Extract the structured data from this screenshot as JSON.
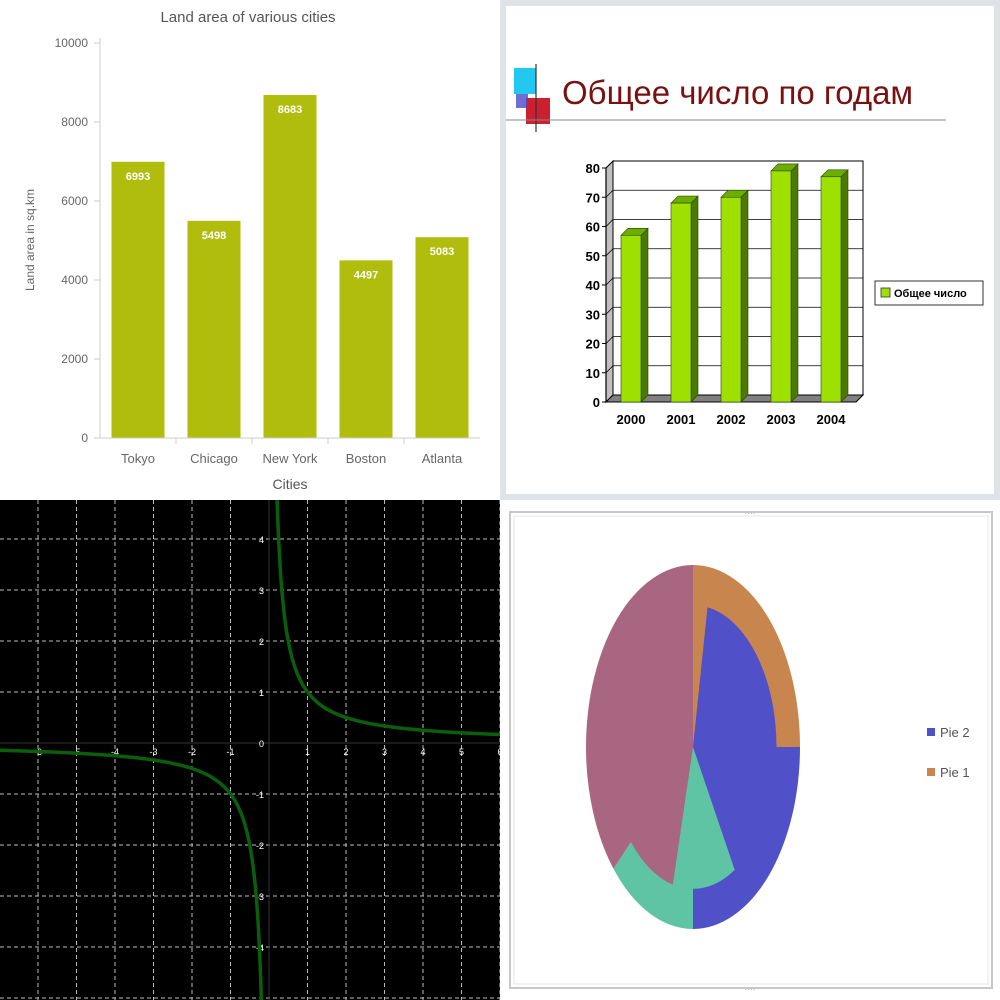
{
  "chart_data": [
    {
      "type": "bar",
      "title": "Land area of various cities",
      "xlabel": "Cities",
      "ylabel": "Land area in sq.km",
      "categories": [
        "Tokyo",
        "Chicago",
        "New York",
        "Boston",
        "Atlanta"
      ],
      "values": [
        6993,
        5498,
        8683,
        4497,
        5083
      ],
      "data_labels": [
        "6993",
        "5498",
        "8683",
        "4497",
        "5083"
      ],
      "ylim": [
        0,
        10000
      ],
      "yticks": [
        0,
        2000,
        4000,
        6000,
        8000,
        10000
      ],
      "ytick_labels": [
        "0",
        "2000",
        "4000",
        "6000",
        "8000",
        "10000"
      ],
      "color": "#b0bd0c",
      "grid": false,
      "legend": "none"
    },
    {
      "type": "bar",
      "title": "Общее число по годам",
      "categories": [
        "2000",
        "2001",
        "2002",
        "2003",
        "2004"
      ],
      "series": [
        {
          "name": "Общее число",
          "values": [
            57,
            68,
            70,
            79,
            77
          ]
        }
      ],
      "ylim": [
        0,
        80
      ],
      "yticks": [
        0,
        10,
        20,
        30,
        40,
        50,
        60,
        70,
        80
      ],
      "ytick_labels": [
        "0",
        "10",
        "20",
        "30",
        "40",
        "50",
        "60",
        "70",
        "80"
      ],
      "style": "3d",
      "color": "#9ee000",
      "title_color": "#7a1010",
      "grid": true,
      "legend": "right"
    },
    {
      "type": "line",
      "function": "y = 1/x",
      "x_range": [
        -6,
        6
      ],
      "y_range": [
        -5,
        5
      ],
      "xtick_labels": [
        "-6",
        "-5",
        "-4",
        "-3",
        "-2",
        "-1",
        "1",
        "2",
        "3",
        "4",
        "5",
        "6"
      ],
      "ytick_labels": [
        "4",
        "3",
        "2",
        "1",
        "0",
        "-1",
        "-2",
        "-3",
        "-4"
      ],
      "line_color": "#0b5e0b",
      "background": "#000000",
      "grid": true,
      "legend": "none"
    },
    {
      "type": "pie",
      "series": [
        {
          "name": "Pie 2",
          "color": "#5050c8"
        },
        {
          "name": "Pie 1",
          "color": "#c8864e"
        }
      ],
      "slices": [
        {
          "ring": "outer",
          "value": 25,
          "color": "#c8864e"
        },
        {
          "ring": "outer",
          "value": 75,
          "color": "#5050c8"
        },
        {
          "ring": "inner",
          "value": 37,
          "color": "#5050c8"
        },
        {
          "ring": "inner",
          "value": 13,
          "color": "#5fc4a4"
        },
        {
          "ring": "inner",
          "value": 50,
          "color": "#a86680"
        },
        {
          "ring": "outer2",
          "value": 13,
          "color": "#5fc4a4"
        },
        {
          "ring": "outer2",
          "value": 25,
          "color": "#a86680"
        }
      ],
      "grid": false,
      "legend": "right"
    }
  ]
}
